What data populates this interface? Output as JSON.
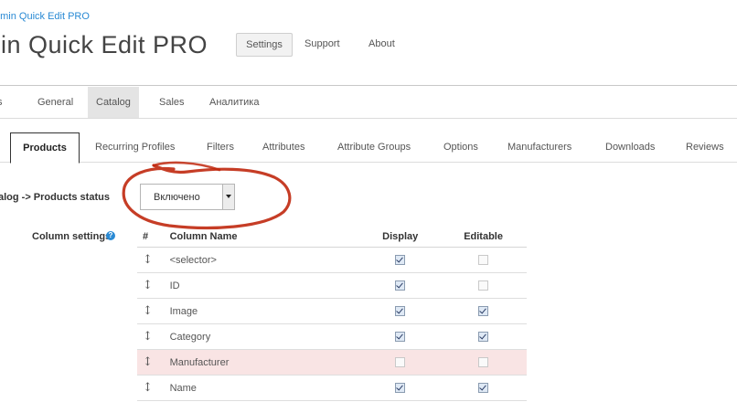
{
  "header": {
    "breadcrumb": "dmin Quick Edit PRO",
    "title": "min Quick Edit PRO",
    "buttons": {
      "settings": "Settings",
      "support": "Support",
      "about": "About"
    }
  },
  "tabs_main": {
    "cut": "s",
    "general": "General",
    "catalog": "Catalog",
    "sales": "Sales",
    "analytics": "Аналитика",
    "active": "Catalog"
  },
  "tabs_catalog": {
    "products": "Products",
    "recurring": "Recurring Profiles",
    "filters": "Filters",
    "attributes": "Attributes",
    "attribute_groups": "Attribute Groups",
    "options": "Options",
    "manufacturers": "Manufacturers",
    "downloads": "Downloads",
    "reviews": "Reviews",
    "active": "Products"
  },
  "form": {
    "status_label": "alog -> Products status",
    "status_value": "Включено",
    "column_settings_label": "Column settings"
  },
  "columns_table": {
    "headers": {
      "hash": "#",
      "name": "Column Name",
      "display": "Display",
      "editable": "Editable"
    },
    "rows": [
      {
        "name": "<selector>",
        "display": true,
        "editable": false,
        "highlighted": false
      },
      {
        "name": "ID",
        "display": true,
        "editable": false,
        "highlighted": false
      },
      {
        "name": "Image",
        "display": true,
        "editable": true,
        "highlighted": false
      },
      {
        "name": "Category",
        "display": true,
        "editable": true,
        "highlighted": false
      },
      {
        "name": "Manufacturer",
        "display": false,
        "editable": false,
        "highlighted": true
      },
      {
        "name": "Name",
        "display": true,
        "editable": true,
        "highlighted": false
      }
    ]
  },
  "colors": {
    "accent": "#2a8ad4",
    "annotation": "#c0280e",
    "row_highlight": "#f9e4e4"
  }
}
